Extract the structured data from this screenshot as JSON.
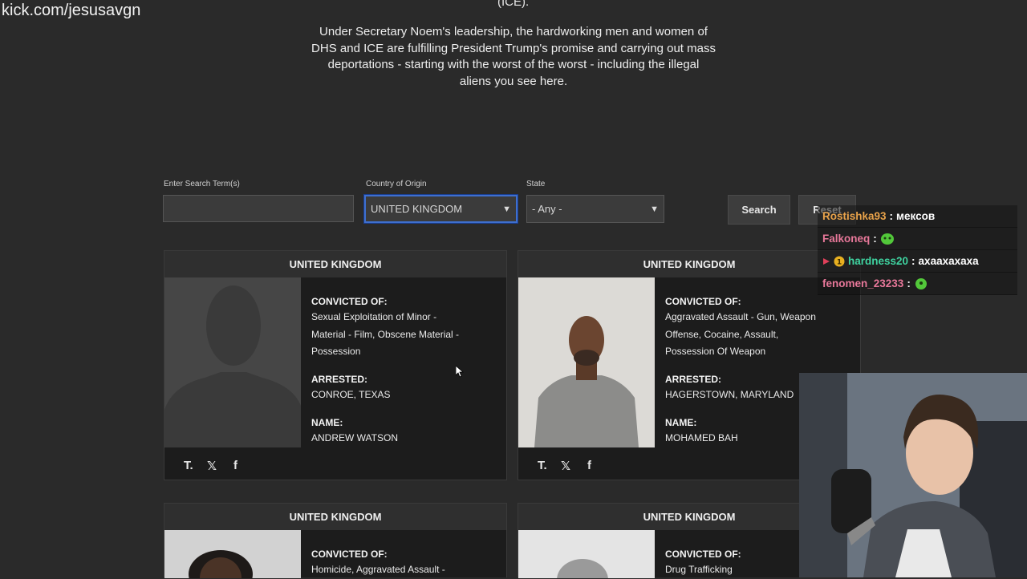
{
  "overlay": {
    "watermark": "kick.com/jesusavgn"
  },
  "header": {
    "ice_fragment": "(ICE).",
    "intro_lines": [
      "Under Secretary Noem's leadership, the hardworking men and women of",
      "DHS and ICE are fulfilling President Trump's promise and carrying out mass",
      "deportations - starting with the worst of the worst - including the illegal",
      "aliens you see here."
    ]
  },
  "filters": {
    "search_label": "Enter Search Term(s)",
    "search_value": "",
    "country_label": "Country of Origin",
    "country_value": "UNITED KINGDOM",
    "state_label": "State",
    "state_value": "- Any -",
    "search_button": "Search",
    "reset_button": "Reset"
  },
  "cards": [
    {
      "country": "UNITED KINGDOM",
      "convicted_label": "CONVICTED OF:",
      "convicted": [
        "Sexual Exploitation of Minor -",
        "Material - Film, Obscene Material -",
        "Possession"
      ],
      "arrested_label": "ARRESTED:",
      "arrested": "CONROE, TEXAS",
      "name_label": "NAME:",
      "name": "ANDREW WATSON",
      "photo": "placeholder-silhouette"
    },
    {
      "country": "UNITED KINGDOM",
      "convicted_label": "CONVICTED OF:",
      "convicted": [
        "Aggravated Assault - Gun, Weapon",
        "Offense, Cocaine, Assault,",
        "Possession Of Weapon"
      ],
      "arrested_label": "ARRESTED:",
      "arrested": "HAGERSTOWN, MARYLAND",
      "name_label": "NAME:",
      "name": "MOHAMED BAH",
      "photo": "mugshot"
    },
    {
      "country": "UNITED KINGDOM",
      "convicted_label": "CONVICTED OF:",
      "convicted": [
        "Homicide, Aggravated Assault -"
      ],
      "photo": "mugshot"
    },
    {
      "country": "UNITED KINGDOM",
      "convicted_label": "CONVICTED OF:",
      "convicted": [
        "Drug Trafficking"
      ],
      "photo": "mugshot"
    }
  ],
  "social_icons": [
    "truth-social-icon",
    "x-icon",
    "facebook-icon"
  ],
  "social_glyphs": {
    "truth": "T.",
    "x": "𝕏",
    "facebook": "f"
  },
  "chat": [
    {
      "user": "Rostishka93",
      "user_color": "#e8a24a",
      "message": "мексов"
    },
    {
      "user": "Falkoneq",
      "user_color": "#e8789a",
      "message": ""
    },
    {
      "user": "hardness20",
      "user_color": "#3fd3a0",
      "message": "ахаахахаха"
    },
    {
      "user": "fenomen_23233",
      "user_color": "#e8789a",
      "message": ""
    }
  ],
  "chat_separator": ":"
}
